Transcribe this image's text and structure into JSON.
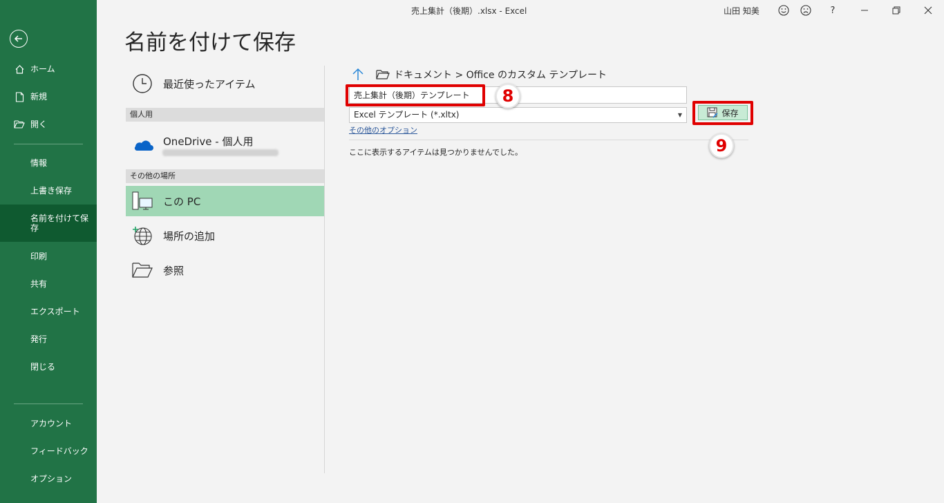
{
  "window": {
    "title": "売上集計（後期）.xlsx  -  Excel",
    "user": "山田 知美",
    "help": "?"
  },
  "sidebar": {
    "home": "ホーム",
    "new": "新規",
    "open": "開く",
    "info": "情報",
    "save": "上書き保存",
    "save_as": "名前を付けて保存",
    "print": "印刷",
    "share": "共有",
    "export": "エクスポート",
    "publish": "発行",
    "close": "閉じる",
    "account": "アカウント",
    "feedback": "フィードバック",
    "options": "オプション"
  },
  "page": {
    "title": "名前を付けて保存"
  },
  "locations": {
    "recent": "最近使ったアイテム",
    "personal_header": "個人用",
    "onedrive": "OneDrive - 個人用",
    "other_header": "その他の場所",
    "this_pc": "この PC",
    "add_place": "場所の追加",
    "browse": "参照"
  },
  "save_pane": {
    "path": "ドキュメント > Office のカスタム テンプレート",
    "filename": "売上集計（後期）テンプレート",
    "filetype": "Excel テンプレート (*.xltx)",
    "save_button": "保存",
    "more_options": "その他のオプション",
    "empty_message": "ここに表示するアイテムは見つかりませんでした。"
  },
  "annotations": {
    "step8": "8",
    "step9": "9",
    "accent_color": "#e00000"
  },
  "colors": {
    "sidebar": "#217346",
    "sidebar_active": "#0f5a30",
    "selected_location": "#a0d7b5"
  }
}
